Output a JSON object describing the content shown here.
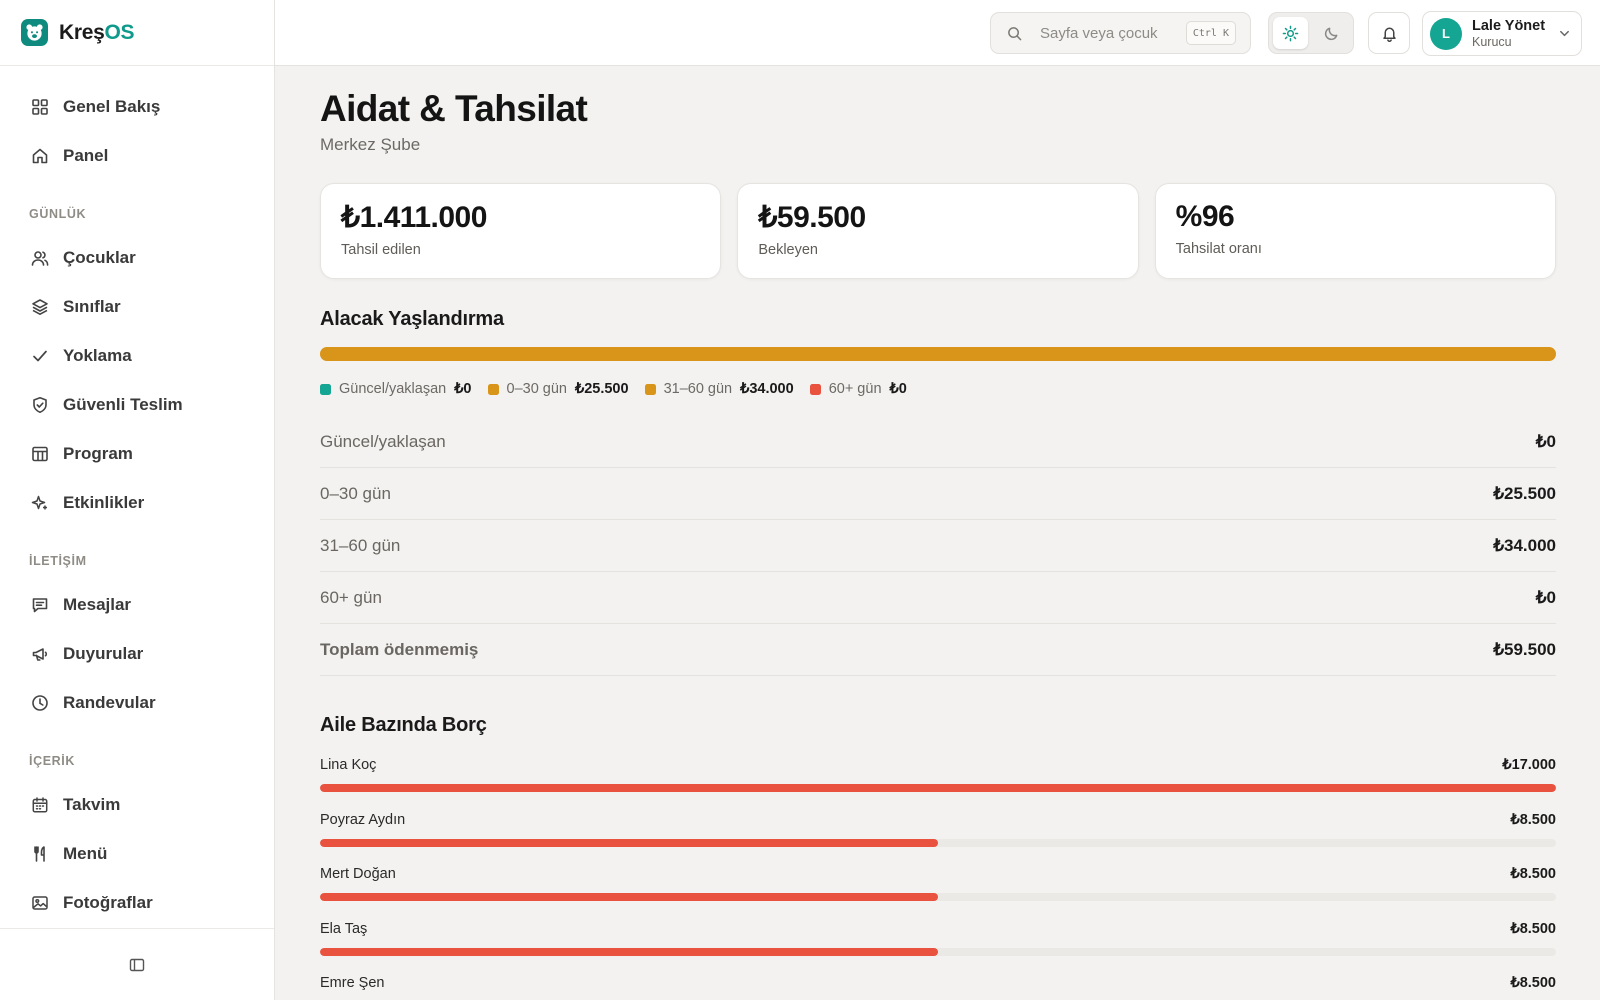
{
  "brand": {
    "prefix": "Kreş",
    "suffix": "OS"
  },
  "sidebar": {
    "top_items": [
      {
        "label": "Genel Bakış",
        "icon": "grid-icon"
      },
      {
        "label": "Panel",
        "icon": "home-icon"
      }
    ],
    "sections": [
      {
        "title": "GÜNLÜK",
        "items": [
          {
            "label": "Çocuklar",
            "icon": "users-icon"
          },
          {
            "label": "Sınıflar",
            "icon": "layers-icon"
          },
          {
            "label": "Yoklama",
            "icon": "check-icon"
          },
          {
            "label": "Güvenli Teslim",
            "icon": "shield-check-icon"
          },
          {
            "label": "Program",
            "icon": "table-icon"
          },
          {
            "label": "Etkinlikler",
            "icon": "sparkles-icon"
          }
        ]
      },
      {
        "title": "İLETİŞİM",
        "items": [
          {
            "label": "Mesajlar",
            "icon": "message-icon"
          },
          {
            "label": "Duyurular",
            "icon": "megaphone-icon"
          },
          {
            "label": "Randevular",
            "icon": "clock-icon"
          }
        ]
      },
      {
        "title": "İÇERİK",
        "items": [
          {
            "label": "Takvim",
            "icon": "calendar-icon"
          },
          {
            "label": "Menü",
            "icon": "utensils-icon"
          },
          {
            "label": "Fotoğraflar",
            "icon": "image-icon"
          }
        ]
      }
    ],
    "footer_icon": "sidebar-toggle-icon"
  },
  "topbar": {
    "search_placeholder": "Sayfa veya çocuk",
    "search_shortcut": "Ctrl K",
    "theme": {
      "active": "light",
      "light_icon": "sun-icon",
      "dark_icon": "moon-icon"
    },
    "bell_icon": "bell-icon",
    "user": {
      "initial": "L",
      "name": "Lale Yönet",
      "role": "Kurucu"
    }
  },
  "page": {
    "title": "Aidat & Tahsilat",
    "subtitle": "Merkez Şube"
  },
  "stats": [
    {
      "value": "₺1.411.000",
      "label": "Tahsil edilen"
    },
    {
      "value": "₺59.500",
      "label": "Bekleyen"
    },
    {
      "value": "%96",
      "label": "Tahsilat oranı"
    }
  ],
  "aging": {
    "title": "Alacak Yaşlandırma",
    "buckets": [
      {
        "label": "Güncel/yaklaşan",
        "amount": "₺0",
        "value": 0,
        "color": "#14a593"
      },
      {
        "label": "0–30 gün",
        "amount": "₺25.500",
        "value": 25500,
        "color": "#d9941a"
      },
      {
        "label": "31–60 gün",
        "amount": "₺34.000",
        "value": 34000,
        "color": "#d9941a"
      },
      {
        "label": "60+ gün",
        "amount": "₺0",
        "value": 0,
        "color": "#e8523e"
      }
    ],
    "total_label": "Toplam ödenmemiş",
    "total_amount": "₺59.500"
  },
  "family_debt": {
    "title": "Aile Bazında Borç",
    "items": [
      {
        "name": "Lina Koç",
        "amount": "₺17.000",
        "value": 17000
      },
      {
        "name": "Poyraz Aydın",
        "amount": "₺8.500",
        "value": 8500
      },
      {
        "name": "Mert Doğan",
        "amount": "₺8.500",
        "value": 8500
      },
      {
        "name": "Ela Taş",
        "amount": "₺8.500",
        "value": 8500
      },
      {
        "name": "Emre Şen",
        "amount": "₺8.500",
        "value": 8500
      }
    ],
    "max_value": 17000
  }
}
